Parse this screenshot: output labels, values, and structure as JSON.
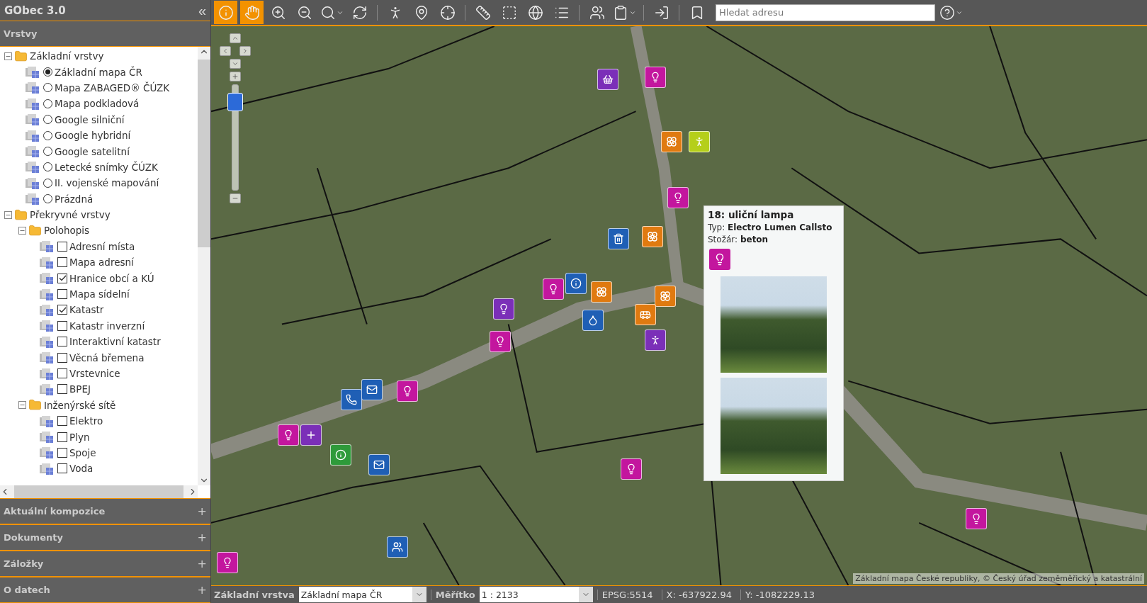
{
  "app": {
    "title": "GObec 3.0",
    "collapse_label": "«"
  },
  "layers_panel": {
    "title": "Vrstvy",
    "tree": [
      {
        "kind": "folder",
        "label": "Základní vrstvy",
        "expanded": true,
        "children": [
          {
            "kind": "radio",
            "label": "Základní mapa ČR",
            "selected": true
          },
          {
            "kind": "radio",
            "label": "Mapa ZABAGED® ČÚZK",
            "selected": false
          },
          {
            "kind": "radio",
            "label": "Mapa podkladová",
            "selected": false
          },
          {
            "kind": "radio",
            "label": "Google silniční",
            "selected": false
          },
          {
            "kind": "radio",
            "label": "Google hybridní",
            "selected": false
          },
          {
            "kind": "radio",
            "label": "Google satelitní",
            "selected": false
          },
          {
            "kind": "radio",
            "label": "Letecké snímky ČÚZK",
            "selected": false
          },
          {
            "kind": "radio",
            "label": "II. vojenské mapování",
            "selected": false
          },
          {
            "kind": "radio",
            "label": "Prázdná",
            "selected": false
          }
        ]
      },
      {
        "kind": "folder",
        "label": "Překryvné vrstvy",
        "expanded": true,
        "children": [
          {
            "kind": "folder",
            "label": "Polohopis",
            "expanded": true,
            "children": [
              {
                "kind": "checkbox",
                "label": "Adresní místa",
                "checked": false
              },
              {
                "kind": "checkbox",
                "label": "Mapa adresní",
                "checked": false
              },
              {
                "kind": "checkbox",
                "label": "Hranice obcí a KÚ",
                "checked": true
              },
              {
                "kind": "checkbox",
                "label": "Mapa sídelní",
                "checked": false
              },
              {
                "kind": "checkbox",
                "label": "Katastr",
                "checked": true
              },
              {
                "kind": "checkbox",
                "label": "Katastr inverzní",
                "checked": false
              },
              {
                "kind": "checkbox",
                "label": "Interaktivní katastr",
                "checked": false
              },
              {
                "kind": "checkbox",
                "label": "Věcná břemena",
                "checked": false
              },
              {
                "kind": "checkbox",
                "label": "Vrstevnice",
                "checked": false
              },
              {
                "kind": "checkbox",
                "label": "BPEJ",
                "checked": false
              }
            ]
          },
          {
            "kind": "folder",
            "label": "Inženýrské sítě",
            "expanded": true,
            "children": [
              {
                "kind": "checkbox",
                "label": "Elektro",
                "checked": false
              },
              {
                "kind": "checkbox",
                "label": "Plyn",
                "checked": false
              },
              {
                "kind": "checkbox",
                "label": "Spoje",
                "checked": false
              },
              {
                "kind": "checkbox",
                "label": "Voda",
                "checked": false
              }
            ]
          }
        ]
      }
    ]
  },
  "accordion": [
    {
      "title": "Aktuální kompozice",
      "sign": "+"
    },
    {
      "title": "Dokumenty",
      "sign": "+"
    },
    {
      "title": "Záložky",
      "sign": "+"
    },
    {
      "title": "O datech",
      "sign": "+"
    }
  ],
  "toolbar": {
    "tools": [
      {
        "kind": "info",
        "selected": true
      },
      {
        "kind": "pan",
        "selected": true
      },
      {
        "kind": "zoom-in",
        "selected": false
      },
      {
        "kind": "zoom-out",
        "selected": false
      },
      {
        "kind": "search",
        "selected": false
      },
      {
        "kind": "refresh",
        "selected": false
      },
      {
        "kind": "sep"
      },
      {
        "kind": "person",
        "selected": false
      },
      {
        "kind": "pin",
        "selected": false
      },
      {
        "kind": "locate",
        "selected": false
      },
      {
        "kind": "sep"
      },
      {
        "kind": "ruler",
        "selected": false
      },
      {
        "kind": "area",
        "selected": false
      },
      {
        "kind": "globe",
        "selected": false
      },
      {
        "kind": "list",
        "selected": false
      },
      {
        "kind": "sep"
      },
      {
        "kind": "users",
        "selected": false
      },
      {
        "kind": "clipboard",
        "selected": false
      },
      {
        "kind": "sep"
      },
      {
        "kind": "login",
        "selected": false
      },
      {
        "kind": "sep"
      },
      {
        "kind": "bookmark",
        "selected": false
      }
    ],
    "search": {
      "placeholder": "Hledat adresu"
    },
    "help": {
      "selected": false
    }
  },
  "map": {
    "zoom_slider": {
      "level": 0.9
    },
    "attribution": "Základní mapa České republiky, © Český úřad zeměměřický a katastrální",
    "popup": {
      "title": "18: uliční lampa",
      "lines": [
        "Typ: **Electro Lumen Callsto**",
        "Stožár: **beton**"
      ]
    }
  },
  "status_bar": {
    "base_layer_label": "Základní vrstva",
    "base_layer_value": "Základní mapa ČR",
    "scale_label": "Měřítko",
    "scale_value": "1 : 2133",
    "epsg": "EPSG:5514",
    "x": "X: -637922.94",
    "y": "Y: -1082229.13"
  }
}
